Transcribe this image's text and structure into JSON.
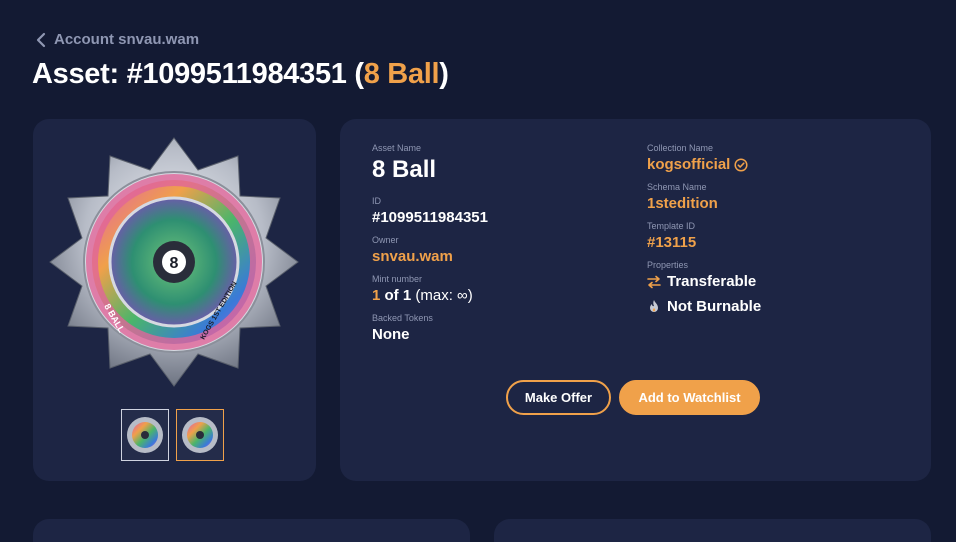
{
  "header": {
    "back_label": "Account snvau.wam",
    "title_prefix": "Asset: #1099511984351 (",
    "title_name": "8 Ball",
    "title_suffix": ")"
  },
  "details": {
    "asset_name_label": "Asset Name",
    "asset_name": "8 Ball",
    "id_label": "ID",
    "id_value": "#1099511984351",
    "owner_label": "Owner",
    "owner_value": "snvau.wam",
    "mint_label": "Mint number",
    "mint_number": "1",
    "mint_of": " of 1",
    "mint_max": " (max: ∞)",
    "backed_label": "Backed Tokens",
    "backed_value": "None",
    "collection_label": "Collection Name",
    "collection_value": "kogsofficial",
    "schema_label": "Schema Name",
    "schema_value": "1stedition",
    "template_label": "Template ID",
    "template_value": "#13115",
    "properties_label": "Properties",
    "prop_transferable": "Transferable",
    "prop_burnable": "Not Burnable"
  },
  "actions": {
    "make_offer": "Make Offer",
    "watchlist": "Add to Watchlist"
  },
  "colors": {
    "background": "#131a33",
    "card": "#1d2544",
    "accent": "#f0a14a",
    "muted": "#8f97b3"
  },
  "icons": {
    "back": "chevron-left-icon",
    "verified": "verified-check-icon",
    "transferable": "transfer-arrows-icon",
    "burnable": "flame-icon"
  },
  "kog_artwork": {
    "center_label": "8",
    "ring_text_1": "8 BALL",
    "ring_text_2": "KOGS 1ST EDITION"
  }
}
